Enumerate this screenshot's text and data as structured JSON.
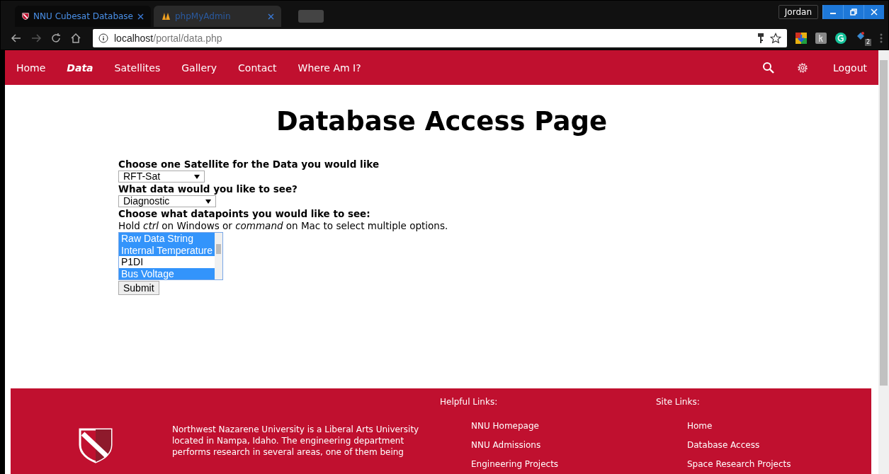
{
  "browser": {
    "tabs": [
      {
        "title": "NNU Cubesat Database",
        "selected": true
      },
      {
        "title": "phpMyAdmin",
        "selected": false
      }
    ],
    "user": "Jordan",
    "address": {
      "host": "localhost",
      "path": "/portal/data.php"
    },
    "extension_badge": "2"
  },
  "nav": {
    "items": [
      {
        "label": "Home",
        "selected": false
      },
      {
        "label": "Data",
        "selected": true
      },
      {
        "label": "Satellites",
        "selected": false
      },
      {
        "label": "Gallery",
        "selected": false
      },
      {
        "label": "Contact",
        "selected": false
      },
      {
        "label": "Where Am I?",
        "selected": false
      }
    ],
    "logout": "Logout"
  },
  "page": {
    "title": "Database Access Page",
    "satellite_label": "Choose one Satellite for the Data you would like",
    "satellite_value": "RFT-Sat",
    "data_label": "What data would you like to see?",
    "data_value": "Diagnostic",
    "points_label": "Choose what datapoints you would like to see:",
    "hint": "Hold *ctrl* on Windows or *command* on Mac to select multiple options.",
    "options": [
      {
        "label": "Raw Data String",
        "selected": true
      },
      {
        "label": "Internal Temperature",
        "selected": true
      },
      {
        "label": "P1DI",
        "selected": false
      },
      {
        "label": "Bus Voltage",
        "selected": true
      }
    ],
    "submit": "Submit"
  },
  "footer": {
    "about": "Northwest Nazarene University is a Liberal Arts University located in Nampa, Idaho. The engineering department performs research in several areas, one of them being",
    "helpful_title": "Helpful Links:",
    "helpful_links": [
      "NNU Homepage",
      "NNU Admissions",
      "Engineering Projects"
    ],
    "site_title": "Site Links:",
    "site_links": [
      "Home",
      "Database Access",
      "Space Research Projects"
    ]
  }
}
